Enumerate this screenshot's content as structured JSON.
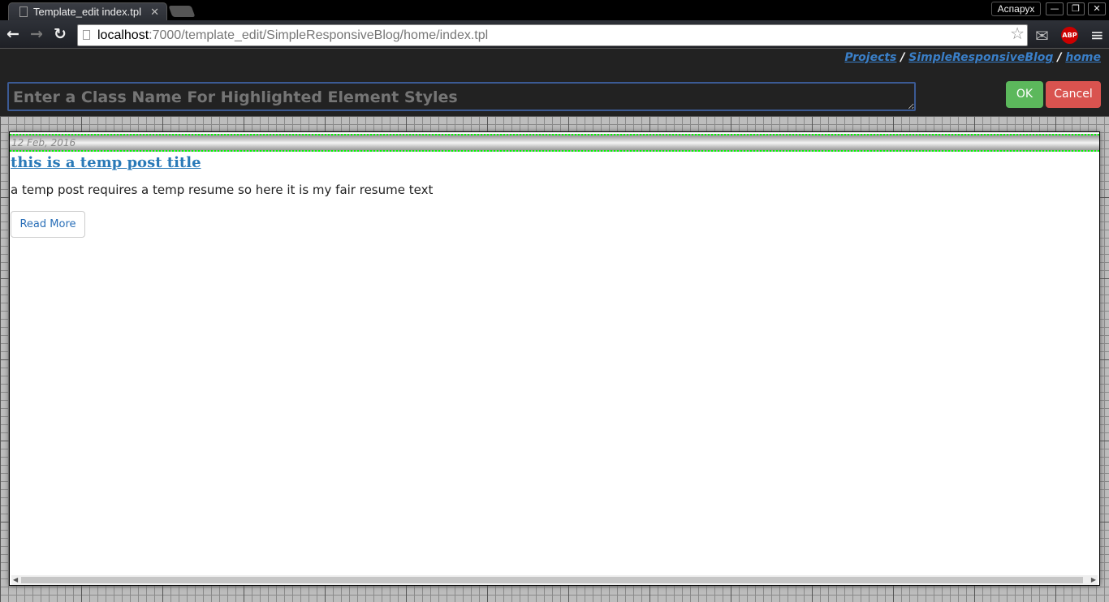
{
  "browser": {
    "tab_title": "Template_edit index.tpl",
    "user": "Аспарух",
    "url_host": "localhost",
    "url_rest": ":7000/template_edit/SimpleResponsiveBlog/home/index.tpl"
  },
  "breadcrumb": [
    {
      "label": "Projects"
    },
    {
      "label": "SimpleResponsiveBlog"
    },
    {
      "label": "home"
    }
  ],
  "editor": {
    "placeholder": "Enter a Class Name For Highlighted Element Styles",
    "ok_label": "OK",
    "cancel_label": "Cancel",
    "ok_color": "#5cb85c",
    "cancel_color": "#d9534f"
  },
  "post": {
    "date": "12 Feb, 2016",
    "title": "this is a temp post title ",
    "resume": "a temp post requires a temp resume so here it is my fair resume text",
    "read_more": "Read More"
  }
}
